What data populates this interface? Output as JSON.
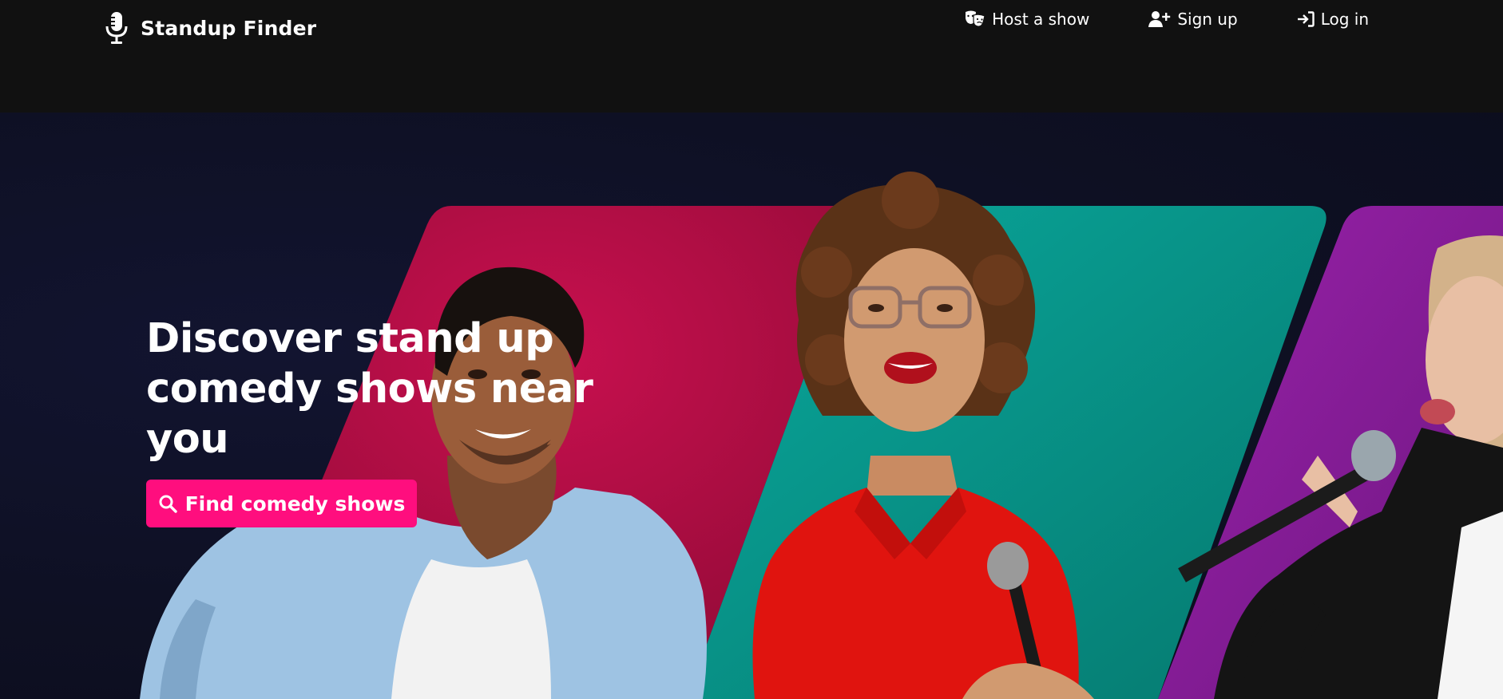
{
  "brand": {
    "name": "Standup Finder",
    "icon": "microphone-icon"
  },
  "nav": {
    "items": [
      {
        "label": "Host a show",
        "icon": "theater-masks-icon"
      },
      {
        "label": "Sign up",
        "icon": "user-plus-icon"
      },
      {
        "label": "Log in",
        "icon": "sign-in-icon"
      }
    ]
  },
  "hero": {
    "title": "Discover stand up comedy shows near you",
    "cta_label": "Find comedy shows",
    "cta_icon": "search-icon"
  },
  "colors": {
    "navbar_bg": "#111111",
    "hero_bg": "#0e1023",
    "accent": "#ff0e7e",
    "panel_crimson": "#b3063f",
    "panel_teal": "#0a9e93",
    "panel_purple": "#8e1c9f"
  }
}
